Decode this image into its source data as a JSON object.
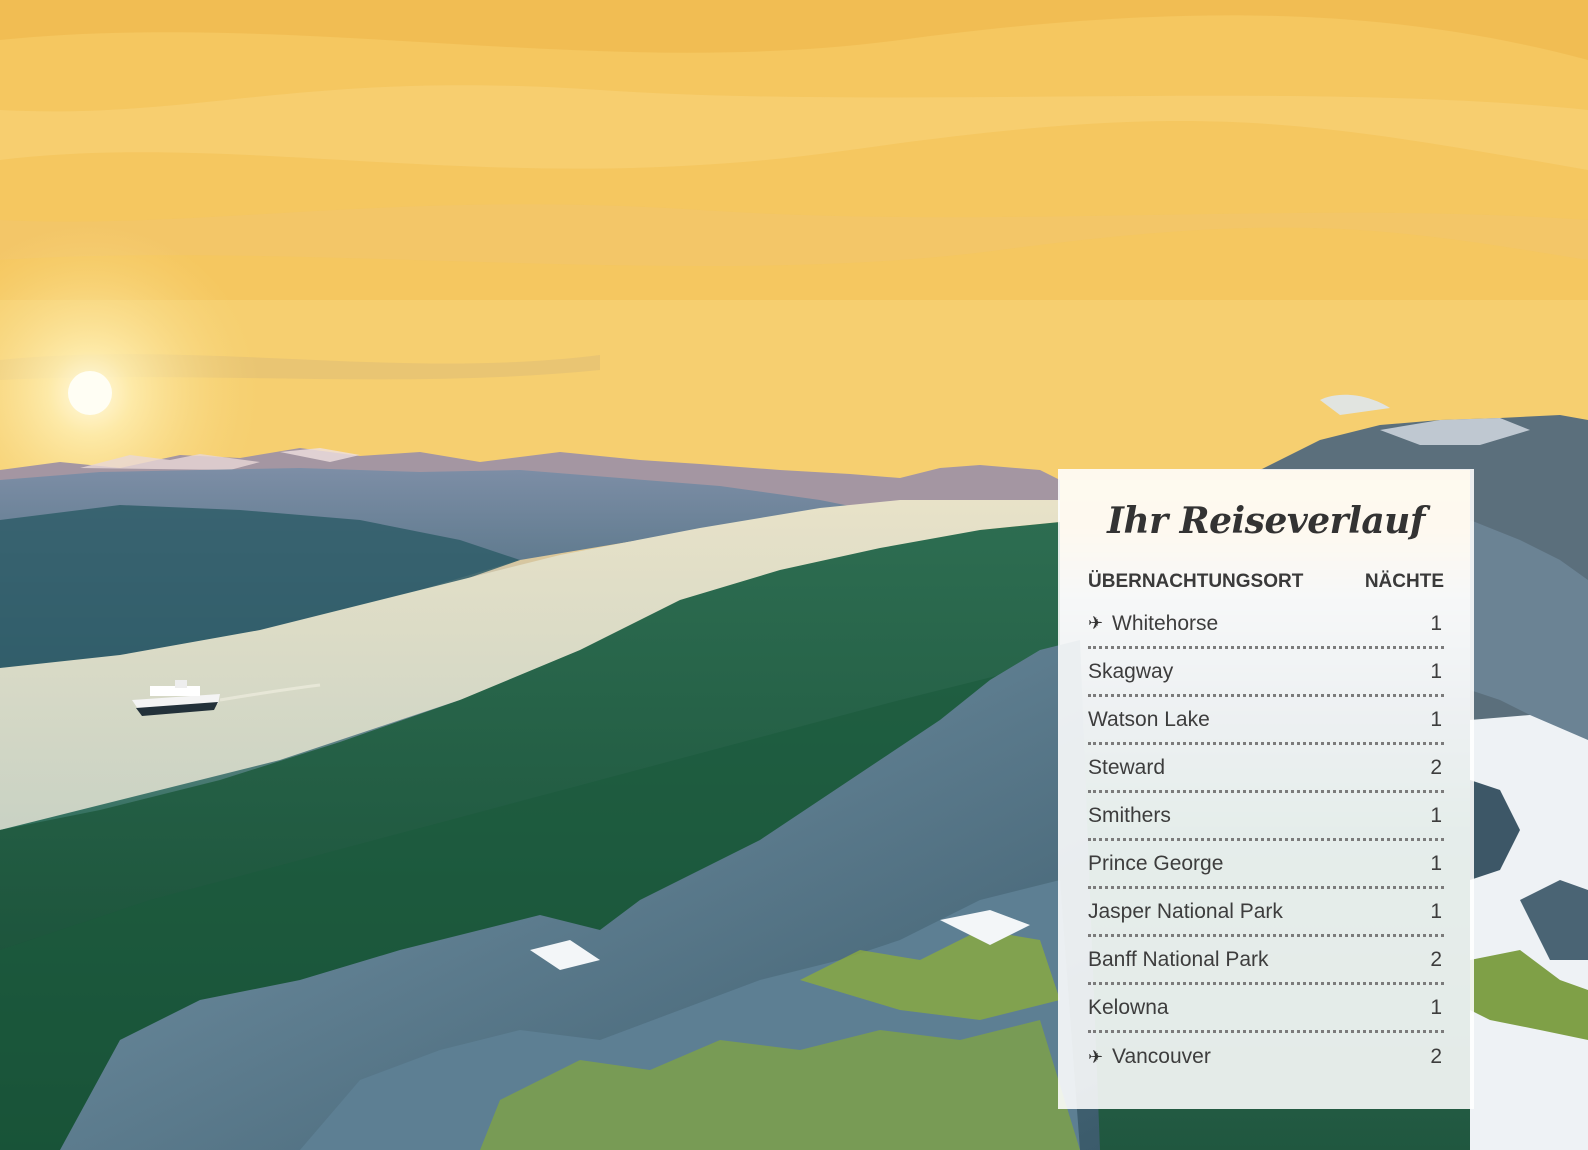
{
  "panel": {
    "title": "Ihr Reiseverlauf",
    "column_place": "ÜBERNACHTUNGSORT",
    "column_nights": "NÄCHTE",
    "rows": [
      {
        "place": "Whitehorse",
        "nights": "1",
        "flight": true
      },
      {
        "place": "Skagway",
        "nights": "1",
        "flight": false
      },
      {
        "place": "Watson Lake",
        "nights": "1",
        "flight": false
      },
      {
        "place": "Steward",
        "nights": "2",
        "flight": false
      },
      {
        "place": "Smithers",
        "nights": "1",
        "flight": false
      },
      {
        "place": "Prince George",
        "nights": "1",
        "flight": false
      },
      {
        "place": "Jasper National Park",
        "nights": "1",
        "flight": false
      },
      {
        "place": "Banff National Park",
        "nights": "2",
        "flight": false
      },
      {
        "place": "Kelowna",
        "nights": "1",
        "flight": false
      },
      {
        "place": "Vancouver",
        "nights": "2",
        "flight": true
      }
    ],
    "flight_icon": "✈"
  },
  "colors": {
    "sky": "#f6cc68",
    "water": "#d9d9c9",
    "forest": "#1f5a3e",
    "rock": "#6f8fa3"
  }
}
